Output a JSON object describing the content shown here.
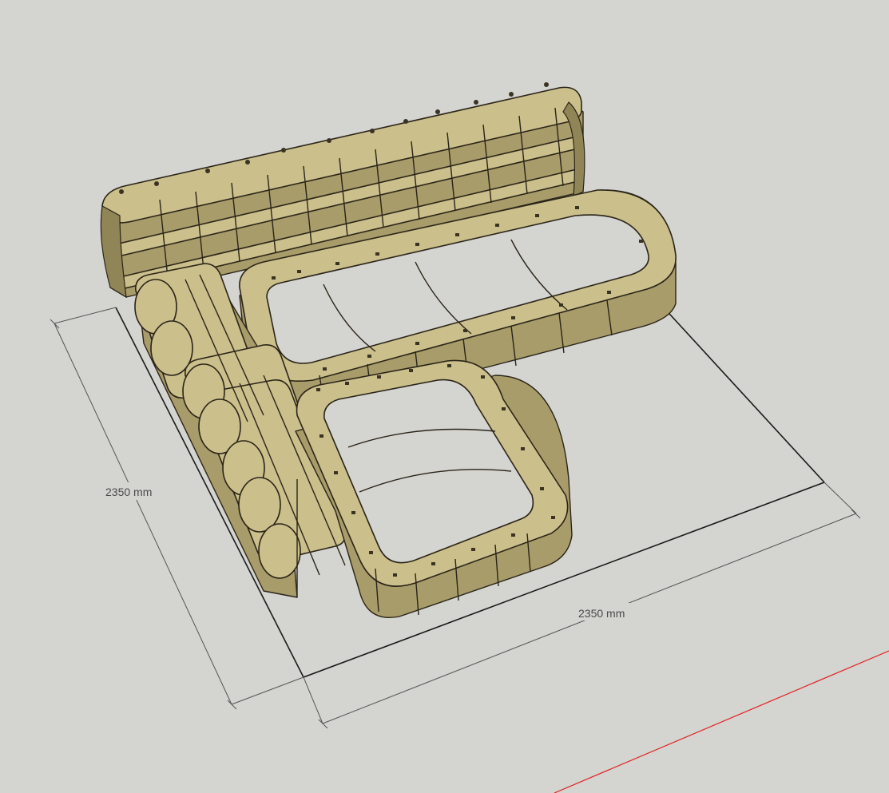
{
  "scene": {
    "background_color": "#d4d4d0",
    "axis_color": "#e02020",
    "plywood_color": "#cbbf8c",
    "outline_color": "#2a2418"
  },
  "dimensions": {
    "left_label": "2350 mm",
    "right_label": "2350 mm"
  }
}
